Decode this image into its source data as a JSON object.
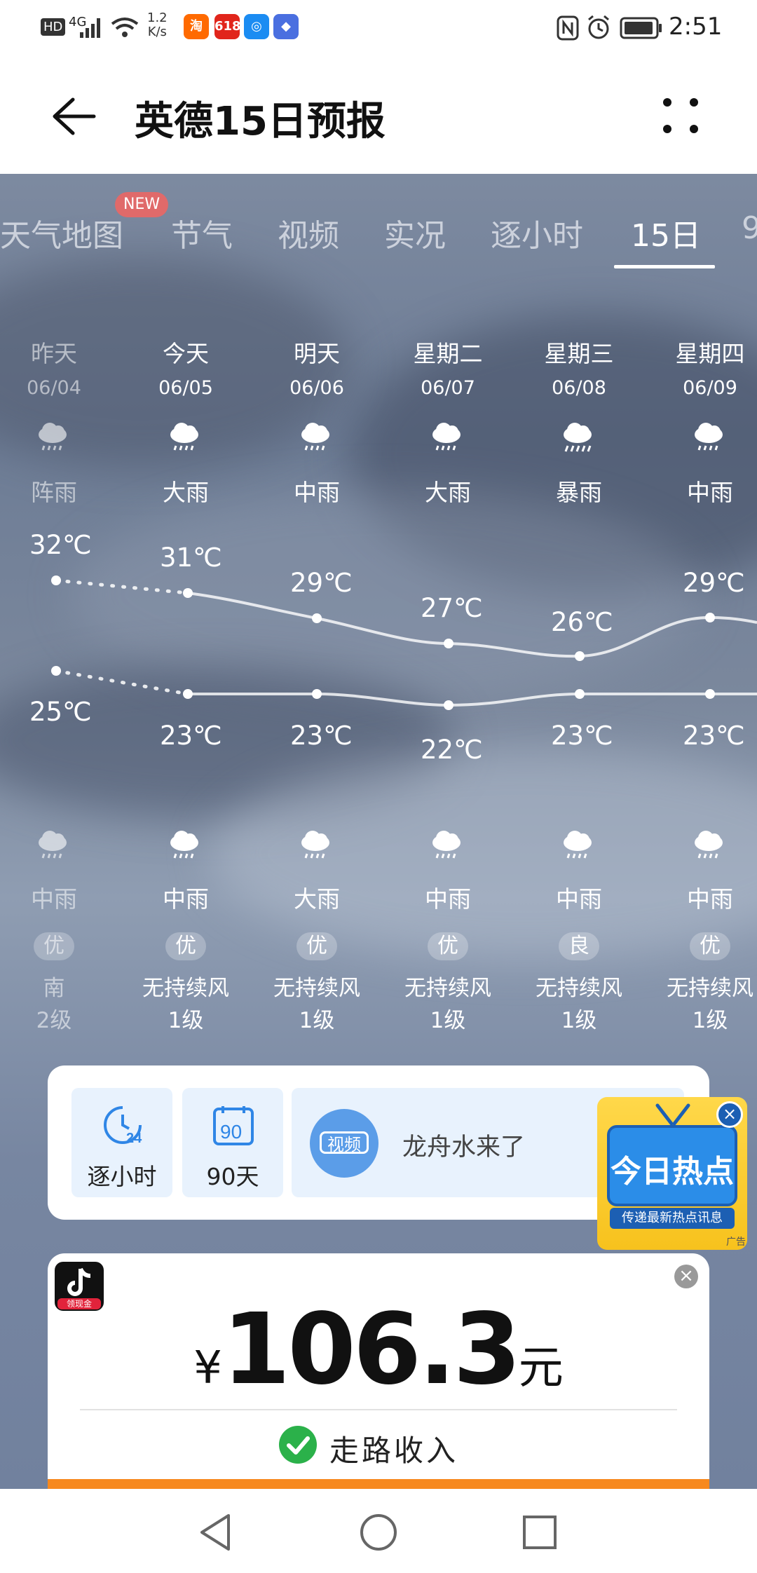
{
  "status_bar": {
    "hd": "HD",
    "network": "4G",
    "speed_value": "1.2",
    "speed_unit": "K/s",
    "time": "2:51",
    "nfc_icon": "nfc-icon",
    "alarm_icon": "alarm-icon",
    "battery_icon": "battery-icon"
  },
  "header": {
    "title": "英德15日预报",
    "back_icon": "arrow-left-icon",
    "more_icon": "more-dots-icon"
  },
  "tabs": [
    {
      "label": "天气地图",
      "badge": "NEW"
    },
    {
      "label": "节气"
    },
    {
      "label": "视频"
    },
    {
      "label": "实况"
    },
    {
      "label": "逐小时"
    },
    {
      "label": "15日",
      "active": true
    },
    {
      "label": "9"
    }
  ],
  "days": [
    {
      "day": "昨天",
      "date": "06/04",
      "cond_day": "阵雨",
      "high": "32℃",
      "low": "25℃",
      "cond_night": "中雨",
      "aqi": "优",
      "wind": "南",
      "level": "2级"
    },
    {
      "day": "今天",
      "date": "06/05",
      "cond_day": "大雨",
      "high": "31℃",
      "low": "23℃",
      "cond_night": "中雨",
      "aqi": "优",
      "wind": "无持续风",
      "level": "1级"
    },
    {
      "day": "明天",
      "date": "06/06",
      "cond_day": "中雨",
      "high": "29℃",
      "low": "23℃",
      "cond_night": "大雨",
      "aqi": "优",
      "wind": "无持续风",
      "level": "1级"
    },
    {
      "day": "星期二",
      "date": "06/07",
      "cond_day": "大雨",
      "high": "27℃",
      "low": "22℃",
      "cond_night": "中雨",
      "aqi": "优",
      "wind": "无持续风",
      "level": "1级"
    },
    {
      "day": "星期三",
      "date": "06/08",
      "cond_day": "暴雨",
      "high": "26℃",
      "low": "23℃",
      "cond_night": "中雨",
      "aqi": "良",
      "wind": "无持续风",
      "level": "1级"
    },
    {
      "day": "星期四",
      "date": "06/09",
      "cond_day": "中雨",
      "high": "29℃",
      "low": "23℃",
      "cond_night": "中雨",
      "aqi": "优",
      "wind": "无持续风",
      "level": "1级"
    }
  ],
  "quick": {
    "hourly_label": "逐小时",
    "hourly_icon_text": "24",
    "days90_label": "90天",
    "days90_icon_text": "90",
    "video_icon_text": "视频",
    "video_title": "龙舟水来了"
  },
  "ad": {
    "title": "今日热点",
    "subtitle": "传递最新热点讯息",
    "tag": "广告"
  },
  "money": {
    "app_badge": "领现金",
    "currency": "¥",
    "amount": "106.3",
    "unit": "元",
    "caption": "走路收入"
  },
  "colors": {
    "accent_blue": "#2f86e6",
    "orange_bar": "#f7891e",
    "check_green": "#2bb14a"
  }
}
